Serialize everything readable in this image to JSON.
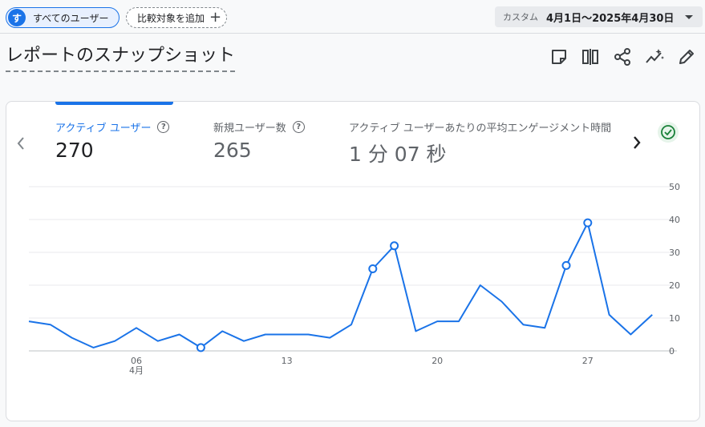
{
  "topbar": {
    "segment": {
      "avatar_letter": "す",
      "label": "すべてのユーザー"
    },
    "compare": {
      "label": "比較対象を追加",
      "plus": "+"
    },
    "date": {
      "tag": "カスタム",
      "value": "4月1日～2025年4月30日"
    }
  },
  "page": {
    "title": "レポートのスナップショット"
  },
  "toolbar": {
    "icons": [
      "note-icon",
      "compare-columns-icon",
      "share-icon",
      "insights-icon",
      "edit-icon"
    ]
  },
  "metrics": [
    {
      "label": "アクティブ ユーザー",
      "value": "270",
      "help": "?"
    },
    {
      "label": "新規ユーザー数",
      "value": "265",
      "help": "?"
    },
    {
      "label": "アクティブ ユーザーあたりの平均エンゲージメント時間",
      "value": "1 分 07 秒"
    }
  ],
  "colors": {
    "accent": "#1a73e8",
    "check": "#188038"
  },
  "chart_data": {
    "type": "line",
    "title": "",
    "xlabel": "",
    "ylabel": "",
    "ylim": [
      0,
      50
    ],
    "y_ticks": [
      "0",
      "10",
      "20",
      "30",
      "40",
      "50"
    ],
    "x_ticks": [
      {
        "day": 6,
        "label": "06",
        "sub": "4月"
      },
      {
        "day": 13,
        "label": "13",
        "sub": ""
      },
      {
        "day": 20,
        "label": "20",
        "sub": ""
      },
      {
        "day": 27,
        "label": "27",
        "sub": ""
      }
    ],
    "grid": true,
    "series": [
      {
        "x": [
          1,
          2,
          3,
          4,
          5,
          6,
          7,
          8,
          9,
          10,
          11,
          12,
          13,
          14,
          15,
          16,
          17,
          18,
          19,
          20,
          21,
          22,
          23,
          24,
          25,
          26,
          27,
          28,
          29,
          30
        ],
        "values": [
          9,
          8,
          4,
          1,
          3,
          7,
          3,
          5,
          1,
          6,
          3,
          5,
          5,
          5,
          4,
          8,
          25,
          32,
          6,
          9,
          9,
          20,
          15,
          8,
          7,
          26,
          39,
          11,
          5,
          11
        ],
        "markers": [
          9,
          17,
          18,
          26,
          27
        ]
      }
    ]
  }
}
